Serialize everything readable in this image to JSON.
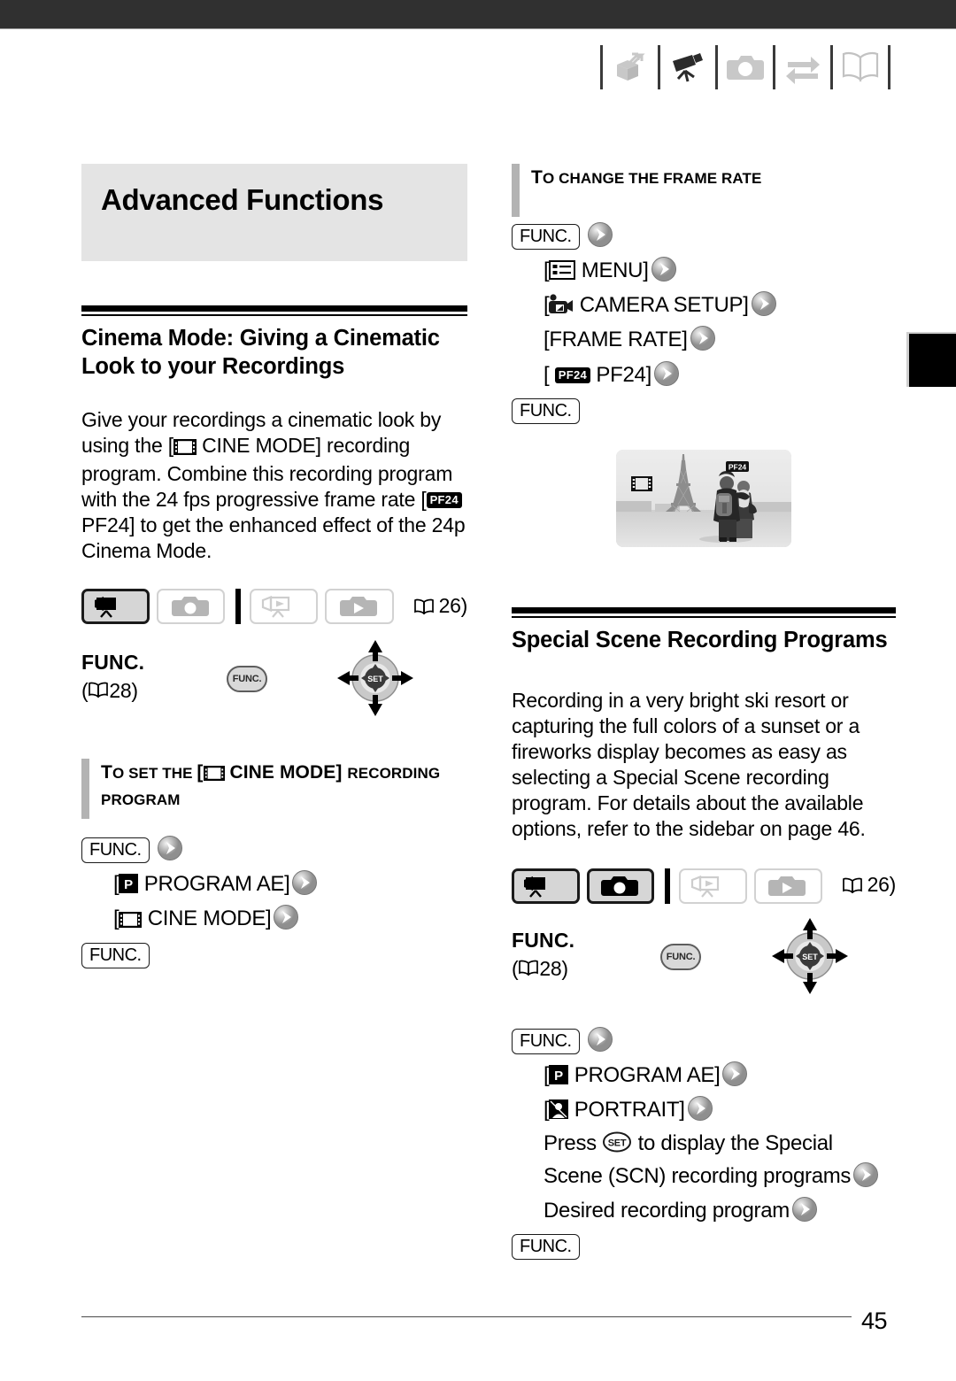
{
  "header": {
    "chapter_icons": [
      {
        "name": "unpack-box-icon",
        "state": "inactive"
      },
      {
        "name": "camcorder-icon",
        "state": "active"
      },
      {
        "name": "photo-camera-icon",
        "state": "inactive"
      },
      {
        "name": "exchange-arrows-icon",
        "state": "inactive"
      },
      {
        "name": "open-book-icon",
        "state": "inactive"
      }
    ]
  },
  "chapter": {
    "title": "Advanced Functions"
  },
  "left": {
    "section_title": "Cinema Mode: Giving a Cinematic Look to your Recordings",
    "body_parts": {
      "p1": "Give your recordings a cinematic look by using the [",
      "p2": " CINE MODE] recording program. Combine this recording program with the 24 fps progressive frame rate [",
      "badge": "PF24",
      "p3": " PF24] to get the enhanced effect of the 24p Cinema Mode."
    },
    "mode_row": {
      "buttons": [
        {
          "name": "mode-camera-record",
          "state": "on"
        },
        {
          "name": "mode-photo-record",
          "state": "off"
        },
        {
          "name": "mode-camera-play",
          "state": "off"
        },
        {
          "name": "mode-photo-play",
          "state": "off"
        }
      ],
      "page_ref": "26"
    },
    "func": {
      "heading": "FUNC.",
      "page_ref": "28",
      "button_label": "FUNC.",
      "joystick_label": "SET"
    },
    "subhead": {
      "pre": "To set the [",
      "post": " CINE MODE] recording program"
    },
    "steps": {
      "func_open": "FUNC.",
      "s1": "[",
      "s1_badge": "P",
      "s1_text": " PROGRAM AE]",
      "s2": "[",
      "s2_text": " CINE MODE]",
      "func_close": "FUNC."
    }
  },
  "right": {
    "subhead": "To change the frame rate",
    "steps": {
      "func_open": "FUNC.",
      "s1_text": "MENU]",
      "s2_text": "CAMERA SETUP]",
      "s3_text": "[FRAME RATE]",
      "s4_badge": "PF24",
      "s4_text": "PF24]",
      "func_close": "FUNC."
    },
    "photo": {
      "alt": "Couple photographing in front of the Eiffel Tower",
      "badge": "PF24",
      "corner_icon": "cine-mode-filmstrip-icon"
    },
    "section_title": "Special Scene Recording Programs",
    "body": "Recording in a very bright ski resort or capturing the full colors of a sunset or a fireworks display becomes as easy as selecting a Special Scene recording program. For details about the available options, refer to the sidebar on page 46.",
    "mode_row": {
      "buttons": [
        {
          "name": "mode-camera-record",
          "state": "on"
        },
        {
          "name": "mode-photo-record",
          "state": "on"
        },
        {
          "name": "mode-camera-play",
          "state": "off"
        },
        {
          "name": "mode-photo-play",
          "state": "off"
        }
      ],
      "page_ref": "26"
    },
    "func": {
      "heading": "FUNC.",
      "page_ref": "28",
      "button_label": "FUNC.",
      "joystick_label": "SET"
    },
    "steps2": {
      "func_open": "FUNC.",
      "s1": "[",
      "s1_badge": "P",
      "s1_text": " PROGRAM AE]",
      "s2": "[",
      "s2_text": " PORTRAIT]",
      "s3a": "Press",
      "s3_btn": "SET",
      "s3b": "to display the Special",
      "s4": "Scene (SCN) recording programs",
      "s5": "Desired recording program",
      "func_close": "FUNC."
    }
  },
  "footer": {
    "page_number": "45"
  },
  "colors": {
    "topbar": "#303030",
    "banner_bg": "#e4e4e4",
    "subhead_bar": "#b3b3b3",
    "active_btn_bg": "#d6d6d6"
  }
}
